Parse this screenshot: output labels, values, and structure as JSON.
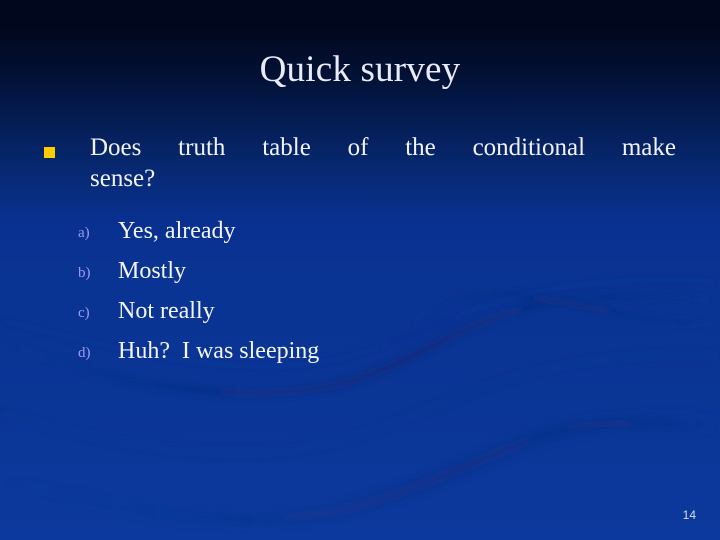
{
  "slide": {
    "title": "Quick survey",
    "page_number": "14",
    "theme": {
      "background_top": "#01071c",
      "background_bottom": "#0c399d",
      "title_color": "#e9ebfb",
      "body_color": "#f2f3fd",
      "bullet_color": "#ffcc00",
      "marker_color": "#9c9ceb",
      "wave_color": "#0b2f86"
    }
  },
  "bullet": {
    "icon": "square-bullet-icon",
    "line1": "Does  truth  table  of  the  conditional  make",
    "line2": "sense?"
  },
  "options": [
    {
      "marker": "a)",
      "label": "Yes, already"
    },
    {
      "marker": "b)",
      "label": "Mostly"
    },
    {
      "marker": "c)",
      "label": "Not really"
    },
    {
      "marker": "d)",
      "label": "Huh?  I was sleeping"
    }
  ]
}
